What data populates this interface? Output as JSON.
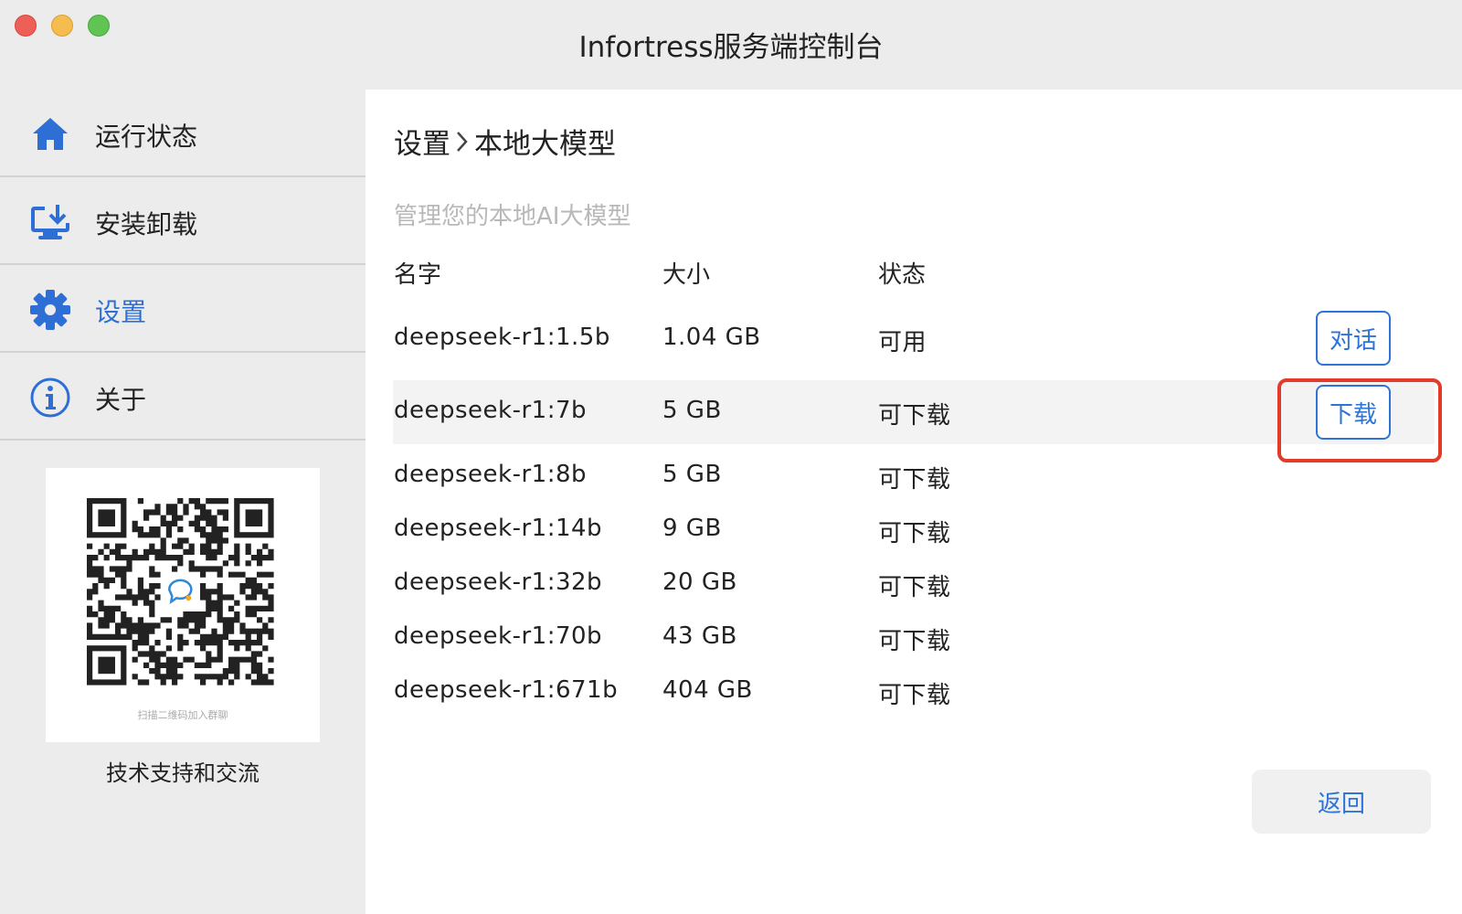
{
  "window": {
    "title": "Infortress服务端控制台"
  },
  "sidebar": {
    "items": [
      {
        "label": "运行状态",
        "icon": "home-icon"
      },
      {
        "label": "安装卸载",
        "icon": "install-icon"
      },
      {
        "label": "设置",
        "icon": "gear-icon",
        "active": true
      },
      {
        "label": "关于",
        "icon": "info-icon"
      }
    ],
    "qr_caption": "扫描二维码加入群聊",
    "support_text": "技术支持和交流"
  },
  "main": {
    "breadcrumb": {
      "parent": "设置",
      "current": "本地大模型"
    },
    "description": "管理您的本地AI大模型",
    "columns": {
      "name": "名字",
      "size": "大小",
      "status": "状态"
    },
    "rows": [
      {
        "name": "deepseek-r1:1.5b",
        "size": "1.04 GB",
        "status": "可用",
        "action": "对话"
      },
      {
        "name": "deepseek-r1:7b",
        "size": "5 GB",
        "status": "可下载",
        "action": "下载"
      },
      {
        "name": "deepseek-r1:8b",
        "size": "5 GB",
        "status": "可下载"
      },
      {
        "name": "deepseek-r1:14b",
        "size": "9 GB",
        "status": "可下载"
      },
      {
        "name": "deepseek-r1:32b",
        "size": "20 GB",
        "status": "可下载"
      },
      {
        "name": "deepseek-r1:70b",
        "size": "43 GB",
        "status": "可下载"
      },
      {
        "name": "deepseek-r1:671b",
        "size": "404 GB",
        "status": "可下载"
      }
    ],
    "back_label": "返回"
  },
  "colors": {
    "accent": "#2e74d8",
    "highlight_border": "#e23b2b",
    "sidebar_bg": "#ececec"
  }
}
